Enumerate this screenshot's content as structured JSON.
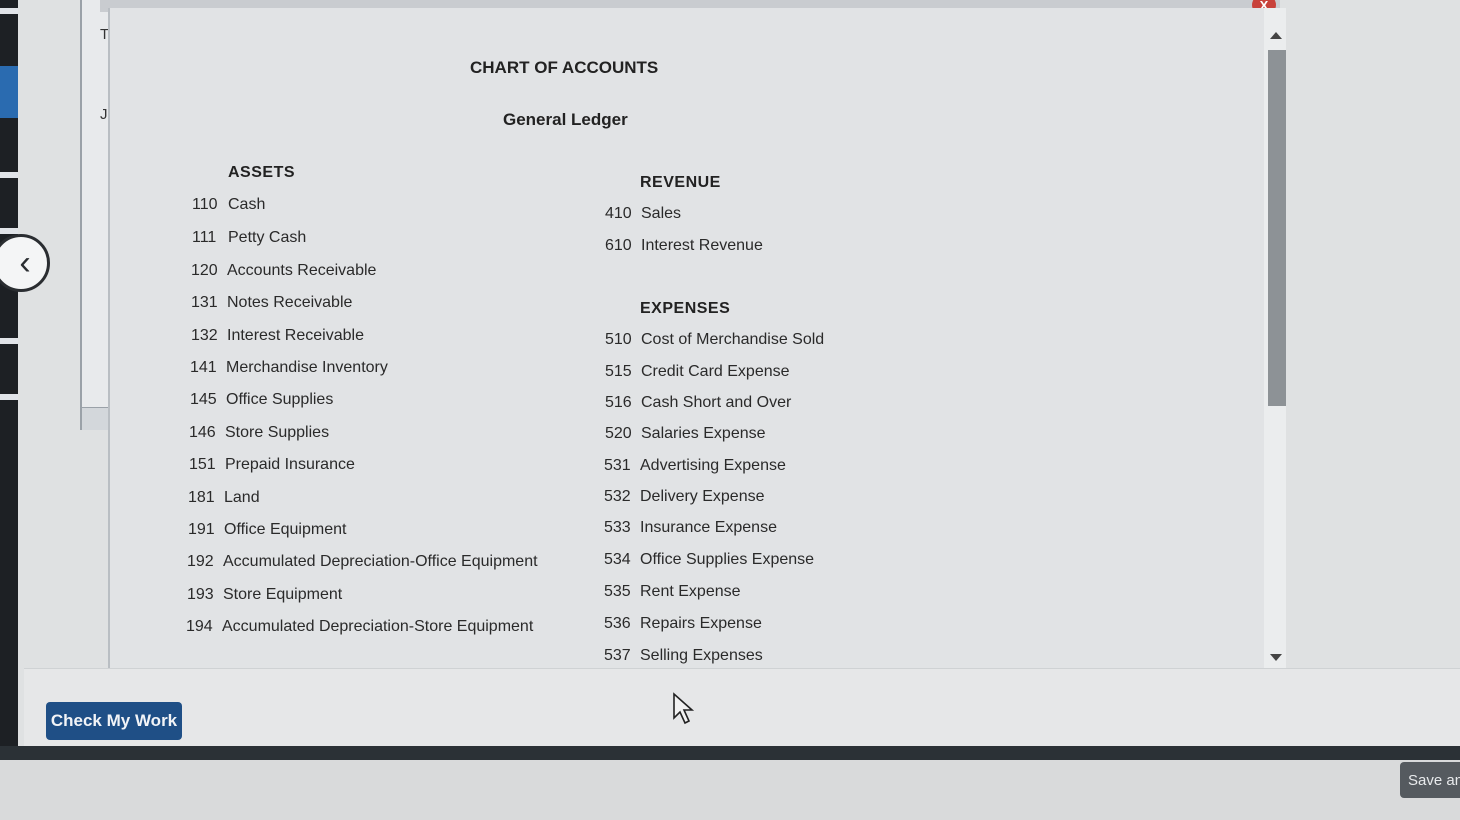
{
  "background": {
    "partial_text_top": "Th",
    "partial_text_mid": "Jo"
  },
  "modal": {
    "title": "CHART OF ACCOUNTS",
    "subtitle": "General Ledger",
    "close_label": "X",
    "assets": {
      "heading": "ASSETS",
      "accounts": [
        {
          "num": "110",
          "name": "Cash"
        },
        {
          "num": "111",
          "name": "Petty Cash"
        },
        {
          "num": "120",
          "name": "Accounts Receivable"
        },
        {
          "num": "131",
          "name": "Notes Receivable"
        },
        {
          "num": "132",
          "name": "Interest Receivable"
        },
        {
          "num": "141",
          "name": "Merchandise Inventory"
        },
        {
          "num": "145",
          "name": "Office Supplies"
        },
        {
          "num": "146",
          "name": "Store Supplies"
        },
        {
          "num": "151",
          "name": "Prepaid Insurance"
        },
        {
          "num": "181",
          "name": "Land"
        },
        {
          "num": "191",
          "name": "Office Equipment"
        },
        {
          "num": "192",
          "name": "Accumulated Depreciation-Office Equipment"
        },
        {
          "num": "193",
          "name": "Store Equipment"
        },
        {
          "num": "194",
          "name": "Accumulated Depreciation-Store Equipment"
        }
      ]
    },
    "revenue": {
      "heading": "REVENUE",
      "accounts": [
        {
          "num": "410",
          "name": "Sales"
        },
        {
          "num": "610",
          "name": "Interest Revenue"
        }
      ]
    },
    "expenses": {
      "heading": "EXPENSES",
      "accounts": [
        {
          "num": "510",
          "name": "Cost of Merchandise Sold"
        },
        {
          "num": "515",
          "name": "Credit Card Expense"
        },
        {
          "num": "516",
          "name": "Cash Short and Over"
        },
        {
          "num": "520",
          "name": "Salaries Expense"
        },
        {
          "num": "531",
          "name": "Advertising Expense"
        },
        {
          "num": "532",
          "name": "Delivery Expense"
        },
        {
          "num": "533",
          "name": "Insurance Expense"
        },
        {
          "num": "534",
          "name": "Office Supplies Expense"
        },
        {
          "num": "535",
          "name": "Rent Expense"
        },
        {
          "num": "536",
          "name": "Repairs Expense"
        },
        {
          "num": "537",
          "name": "Selling Expenses"
        }
      ]
    }
  },
  "footer": {
    "check_button": "Check My Work",
    "save_button": "Save an"
  },
  "icons": {
    "back": "chevron-left-icon",
    "cursor": "mouse-pointer-icon"
  },
  "colors": {
    "primary_button": "#1f4f86",
    "close_button": "#c8413a"
  }
}
